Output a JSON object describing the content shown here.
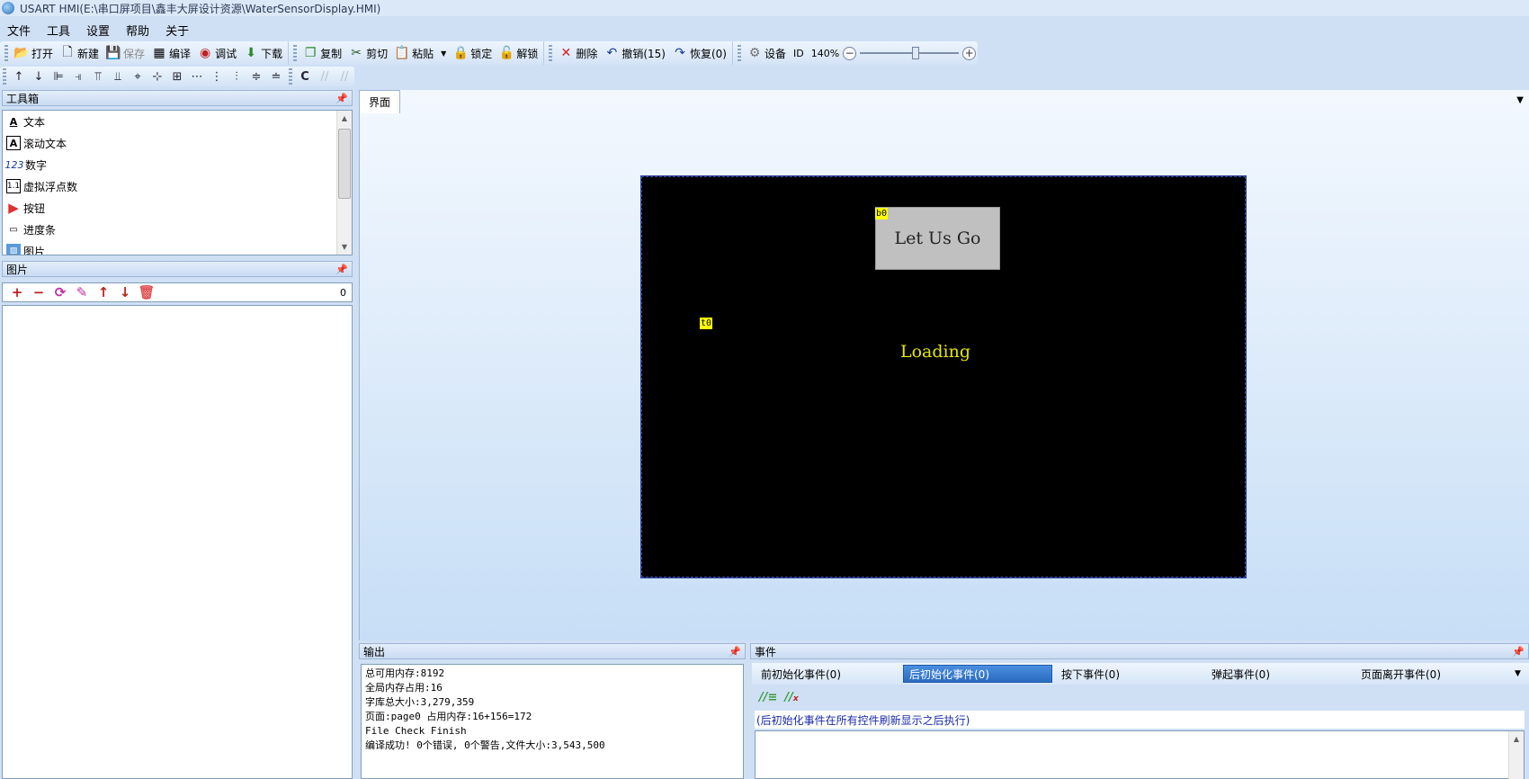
{
  "window": {
    "title": "USART HMI(E:\\串口屏项目\\鑫丰大屏设计资源\\WaterSensorDisplay.HMI)"
  },
  "menu": [
    "文件",
    "工具",
    "设置",
    "帮助",
    "关于"
  ],
  "toolbar": {
    "open": "打开",
    "new": "新建",
    "save": "保存",
    "compile": "编译",
    "debug": "调试",
    "download": "下载",
    "copy": "复制",
    "cut": "剪切",
    "paste": "粘贴",
    "lock": "锁定",
    "unlock": "解锁",
    "delete": "删除",
    "undo": "撤销(15)",
    "redo": "恢复(0)",
    "device": "设备",
    "id": "ID",
    "zoom": "140%"
  },
  "toolbox": {
    "title": "工具箱",
    "items": [
      {
        "label": "文本",
        "icon": "text-icon"
      },
      {
        "label": "滚动文本",
        "icon": "scroll-text-icon"
      },
      {
        "label": "数字",
        "icon": "number-icon"
      },
      {
        "label": "虚拟浮点数",
        "icon": "float-icon"
      },
      {
        "label": "按钮",
        "icon": "button-icon"
      },
      {
        "label": "进度条",
        "icon": "progress-icon"
      },
      {
        "label": "图片",
        "icon": "picture-icon"
      }
    ]
  },
  "images": {
    "title": "图片",
    "count": "0"
  },
  "workspace": {
    "tab": "界面"
  },
  "canvas": {
    "button": {
      "id": "b0",
      "label": "Let Us Go"
    },
    "text": {
      "id": "t0",
      "label": "Loading"
    }
  },
  "output": {
    "title": "输出",
    "lines": [
      "总可用内存:8192",
      "全局内存占用:16",
      "字库总大小:3,279,359",
      "页面:page0 占用内存:16+156=172",
      "File Check Finish",
      "编译成功! 0个错误, 0个警告,文件大小:3,543,500"
    ]
  },
  "events": {
    "title": "事件",
    "tabs": [
      "前初始化事件(0)",
      "后初始化事件(0)",
      "按下事件(0)",
      "弹起事件(0)",
      "页面离开事件(0)"
    ],
    "active_tab": 1,
    "description": "(后初始化事件在所有控件刷新显示之后执行)"
  },
  "colors": {
    "canvas_bg": "#000000",
    "text_color": "#e6e600",
    "button_bg": "#c0c0c0",
    "tag_bg": "#ffff00"
  }
}
